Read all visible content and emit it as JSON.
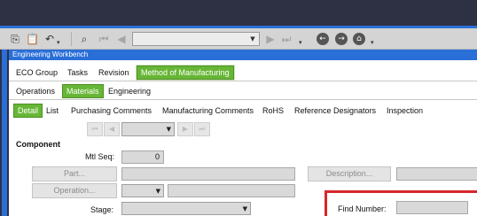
{
  "colors": {
    "titlebar": "#2e3143",
    "accent_blue": "#2a6fd8",
    "active_tab": "#67b636",
    "highlight_red": "#d8262c"
  },
  "toolbar": {
    "icons": [
      "copy-icon",
      "paste-icon",
      "undo-icon",
      "binoculars-icon",
      "first-record-icon",
      "prev-record-icon",
      "next-record-icon",
      "last-record-icon",
      "back-icon",
      "forward-icon",
      "home-icon"
    ],
    "record_combo_value": ""
  },
  "window": {
    "title": "Engineering Workbench"
  },
  "tabs_row1": [
    "ECO Group",
    "Tasks",
    "Revision",
    "Method of Manufacturing"
  ],
  "tabs_row2": [
    "Operations",
    "Materials",
    "Engineering"
  ],
  "tabs_row3": [
    "Detail",
    "List",
    "Purchasing Comments",
    "Manufacturing Comments",
    "RoHS",
    "Reference Designators",
    "Inspection"
  ],
  "active": {
    "row1": "Method of Manufacturing",
    "row2": "Materials",
    "row3": "Detail"
  },
  "component": {
    "section_title": "Component",
    "mtl_seq_label": "Mtl Seq:",
    "mtl_seq_value": "0",
    "part_button": "Part...",
    "part_value": "",
    "description_button": "Description...",
    "description_value": "",
    "operation_button": "Operation...",
    "operation_value": "",
    "stage_label": "Stage:",
    "stage_value": "",
    "find_number_label": "Find Number:",
    "find_number_value": ""
  }
}
